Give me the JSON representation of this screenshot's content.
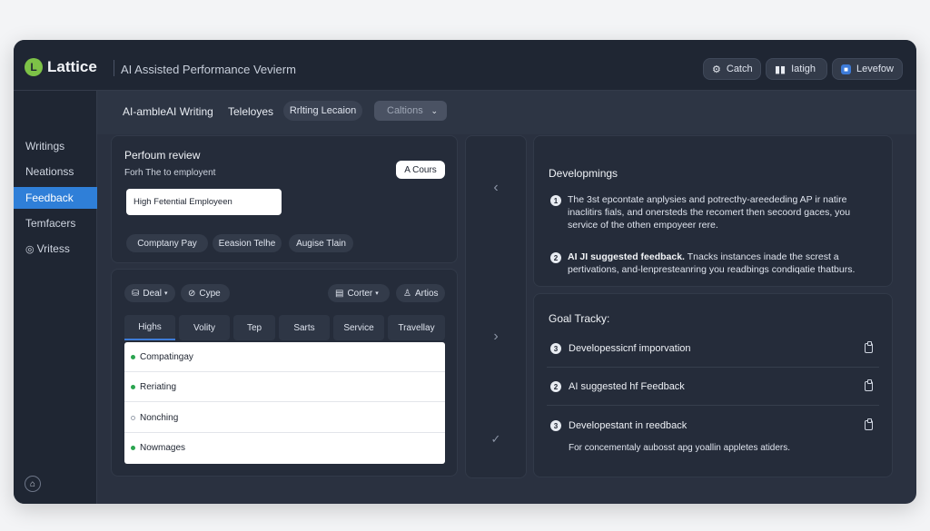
{
  "header": {
    "logo_mark": "L",
    "logo_text": "Lattice",
    "app_title": "AI Assisted Performance Vevierm",
    "buttons": [
      {
        "icon": "gear-icon",
        "glyph": "⚙",
        "label": "Catch"
      },
      {
        "icon": "chart-icon",
        "glyph": "▮▮",
        "label": "Iatigh"
      },
      {
        "icon": "app-icon",
        "glyph": "■",
        "label": "Levefow"
      }
    ]
  },
  "sidebar": {
    "items": [
      {
        "label": "Writings"
      },
      {
        "label": "Neationss"
      },
      {
        "label": "Feedback",
        "active": true
      },
      {
        "label": "Temfacers"
      },
      {
        "label": "Vritess",
        "glyph": "◎"
      }
    ],
    "home_glyph": "⌂"
  },
  "toolbar": {
    "label1": "AI-ambleAI Writing",
    "label2": "Teleloyes",
    "pill": "Rrlting Lecaion",
    "select": "Caltions",
    "select_chevron": "⌄"
  },
  "review": {
    "title": "Perfoum review",
    "subtitle": "Forh The to employent",
    "badge": "A Cours",
    "input_value": "High Fetential Employeen",
    "chips": [
      "Comptany Pay",
      "Eeasion Telhe",
      "Augise Tlain"
    ]
  },
  "table": {
    "filters": [
      {
        "glyph": "⛁",
        "label": "Deal",
        "dropdown": "▾"
      },
      {
        "glyph": "⊘",
        "label": "Cype",
        "dropdown": ""
      },
      {
        "glyph": "▤",
        "label": "Corter",
        "dropdown": "▾"
      },
      {
        "glyph": "♙",
        "label": "Artios",
        "dropdown": ""
      }
    ],
    "tabs": [
      "Highs",
      "Volity",
      "Tep",
      "Sarts",
      "Service",
      "Travellay"
    ],
    "rows": [
      {
        "label": "Compatingay",
        "status": "filled"
      },
      {
        "label": "Reriating",
        "status": "filled"
      },
      {
        "label": "Nonching",
        "status": "hollow"
      },
      {
        "label": "Nowmages",
        "status": "filled"
      }
    ]
  },
  "middle": {
    "arrows": [
      "‹",
      "›",
      "✓"
    ]
  },
  "developments": {
    "title": "Developmings",
    "items": [
      {
        "num": "1",
        "bold": "",
        "text": "The 3st epcontate anplysies and potrecthy-areededing AP ir natire inaclitirs fials, and onersteds the recomert then secoord gaces, you service of the othen empoyeer rere."
      },
      {
        "num": "2",
        "bold": "AI JI suggested feedback.",
        "text": " Tnacks instances inade the screst a pertivations, and-lenpresteanring you readbings condiqatie thatburs."
      }
    ]
  },
  "goals": {
    "title": "Goal Tracky:",
    "items": [
      {
        "num": "3",
        "label": "Developessicnf imporvation"
      },
      {
        "num": "2",
        "label": "AI suggested hf Feedback"
      },
      {
        "num": "3",
        "label": "Developestant in reedback"
      }
    ],
    "footer": "For concementaly aubosst apg yoallin appletes atiders."
  }
}
